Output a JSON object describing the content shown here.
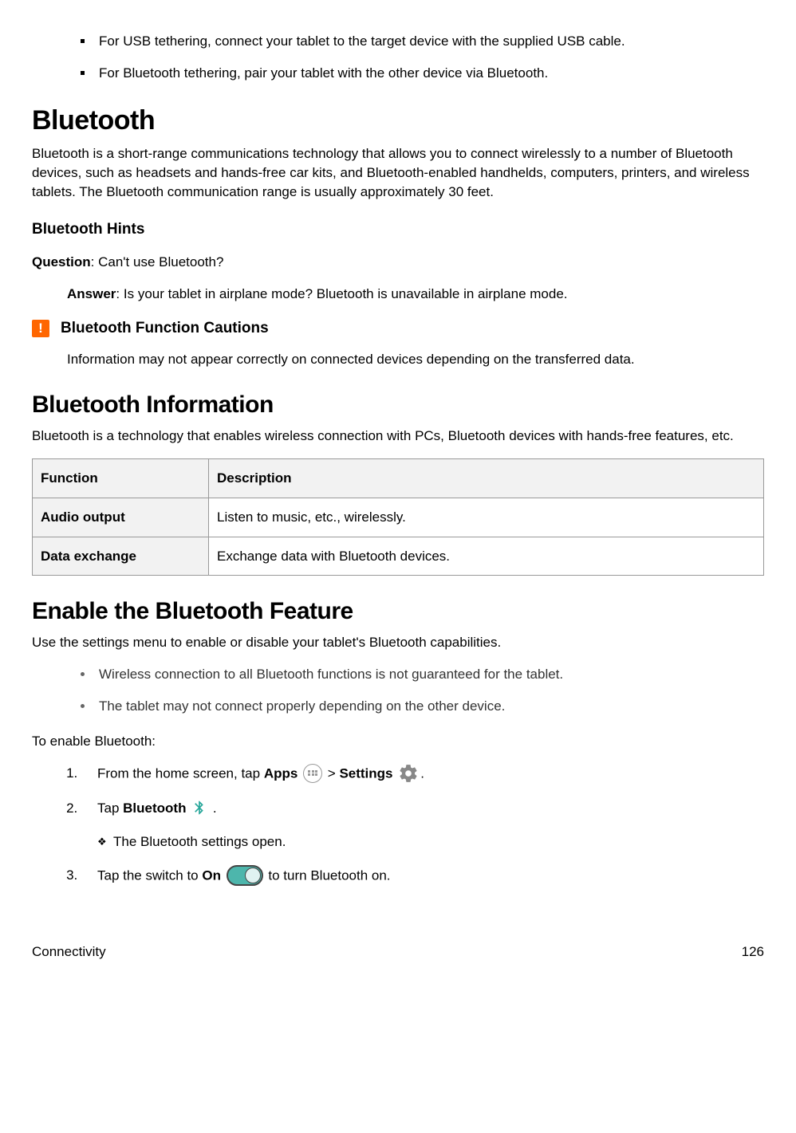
{
  "top_bullets": [
    "For USB tethering, connect your tablet to the target device with the supplied USB cable.",
    "For Bluetooth tethering, pair your tablet with the other device via Bluetooth."
  ],
  "bluetooth": {
    "heading": "Bluetooth",
    "intro": "Bluetooth is a short-range communications technology that allows you to connect wirelessly to a number of Bluetooth devices, such as headsets and hands-free car kits, and Bluetooth-enabled handhelds, computers, printers, and wireless tablets. The Bluetooth communication range is usually approximately 30 feet.",
    "hints_heading": "Bluetooth Hints",
    "question_label": "Question",
    "question_text": ": Can't use Bluetooth?",
    "answer_label": "Answer",
    "answer_text": ": Is your tablet in airplane mode? Bluetooth is unavailable in airplane mode.",
    "caution_heading": "Bluetooth Function Cautions",
    "caution_text": "Information may not appear correctly on connected devices depending on the transferred data."
  },
  "info": {
    "heading": "Bluetooth Information",
    "intro": "Bluetooth is a technology that enables wireless connection with PCs, Bluetooth devices with hands-free features, etc.",
    "table": {
      "col1": "Function",
      "col2": "Description",
      "rows": [
        {
          "fn": "Audio output",
          "desc": "Listen to music, etc., wirelessly."
        },
        {
          "fn": "Data exchange",
          "desc": "Exchange data with Bluetooth devices."
        }
      ]
    }
  },
  "enable": {
    "heading": "Enable the Bluetooth Feature",
    "intro": "Use the settings menu to enable or disable your tablet's Bluetooth capabilities.",
    "notes": [
      "Wireless connection to all Bluetooth functions is not guaranteed for the tablet.",
      "The tablet may not connect properly depending on the other device."
    ],
    "to_enable": "To enable Bluetooth:",
    "step1_a": "From the home screen, tap ",
    "step1_apps": "Apps",
    "step1_gt": " > ",
    "step1_settings": "Settings",
    "step1_end": ".",
    "step2_a": "Tap ",
    "step2_bt": "Bluetooth",
    "step2_end": " .",
    "step2_sub": "The Bluetooth settings open.",
    "step3_a": "Tap the switch to ",
    "step3_on": "On",
    "step3_end": " to turn Bluetooth on."
  },
  "footer": {
    "section": "Connectivity",
    "page": "126"
  }
}
